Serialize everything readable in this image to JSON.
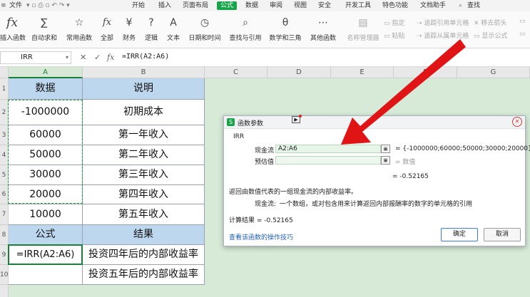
{
  "menu": {
    "items": [
      {
        "label": "文件"
      },
      {
        "label": "开始"
      },
      {
        "label": "插入"
      },
      {
        "label": "页面布局"
      },
      {
        "label": "公式",
        "active": true
      },
      {
        "label": "数据"
      },
      {
        "label": "审阅"
      },
      {
        "label": "视图"
      },
      {
        "label": "安全"
      },
      {
        "label": "开发工具"
      },
      {
        "label": "特色功能"
      },
      {
        "label": "文档助手"
      },
      {
        "label": "查找"
      }
    ]
  },
  "ribbon": {
    "insert_function": {
      "label": "插入函数",
      "icon": "fx-icon",
      "glyph": "fx"
    },
    "autosum": {
      "label": "自动求和",
      "glyph": "∑"
    },
    "common": {
      "label": "常用函数",
      "glyph": "☆"
    },
    "all": {
      "label": "全部",
      "glyph": "fx"
    },
    "finance": {
      "label": "财务",
      "glyph": "¥"
    },
    "logic": {
      "label": "逻辑",
      "glyph": "?"
    },
    "text": {
      "label": "文本",
      "glyph": "A"
    },
    "datetime": {
      "label": "日期和时间",
      "glyph": "◷"
    },
    "lookup": {
      "label": "查找与引用",
      "glyph": "⌕"
    },
    "math": {
      "label": "数学和三角",
      "glyph": "θ"
    },
    "other": {
      "label": "其他函数",
      "glyph": "⋯"
    },
    "name_manager": {
      "label": "名称管理器",
      "glyph": "▤"
    },
    "specify": {
      "label": "指定"
    },
    "paste": {
      "label": "粘贴"
    },
    "trace_precedents": {
      "label": "追踪引用单元格"
    },
    "trace_dependents": {
      "label": "追踪从属单元格"
    },
    "remove_arrows": {
      "label": "移去箭头"
    },
    "show_formulas": {
      "label": "显示公式"
    }
  },
  "formula_bar": {
    "name_box": "IRR",
    "cancel": "✕",
    "confirm": "✓",
    "fx": "fx",
    "formula": "=IRR(A2:A6)"
  },
  "sheet": {
    "columns": [
      "A",
      "B",
      "C",
      "D",
      "E",
      "F",
      "G"
    ],
    "rows": [
      "1",
      "2",
      "3",
      "4",
      "5",
      "6",
      "7",
      "8",
      "9",
      "10"
    ],
    "cells": {
      "a1": "数据",
      "b1": "说明",
      "a2": "-1000000",
      "b2": "初期成本",
      "a3": "60000",
      "b3": "第一年收入",
      "a4": "50000",
      "b4": "第二年收入",
      "a5": "30000",
      "b5": "第三年收入",
      "a6": "20000",
      "b6": "第四年收入",
      "a7": "10000",
      "b7": "第五年收入",
      "a8": "公式",
      "b8": "结果",
      "a9": "=IRR(A2:A6)",
      "b9": "投资四年后的内部收益率",
      "a10": "",
      "b10": "投资五年后的内部收益率"
    }
  },
  "dialog": {
    "title": "函数参数",
    "function_name": "IRR",
    "param1_label": "现金流",
    "param1_value": "A2:A6",
    "param1_result": "= {-1000000;60000;50000;30000;20000}",
    "param2_label": "预估值",
    "param2_result": "= 数值",
    "function_result": "= -0.52165",
    "description": "返回由数值代表的一组现金流的内部收益率。",
    "param_help_label": "现金流:",
    "param_help": "一个数组，或对包含用来计算返回内部报酬率的数字的单元格的引用",
    "calc_result": "计算结果 =  -0.52165",
    "link": "查看该函数的操作技巧",
    "ok": "确定",
    "cancel": "取消"
  },
  "colors": {
    "accent": "#16a34a",
    "header_fill": "#bdd7ee",
    "arrow": "#e01414"
  }
}
